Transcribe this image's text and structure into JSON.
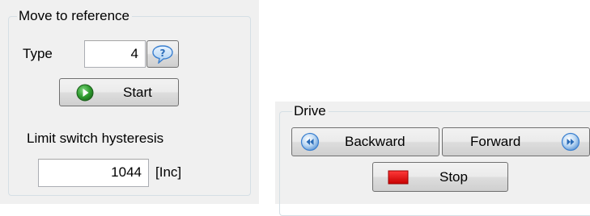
{
  "move_to_reference": {
    "title": "Move to reference",
    "type_label": "Type",
    "type_value": "4",
    "help_icon": "help-speech-bubble-icon",
    "start_label": "Start",
    "start_icon": "play-circle-icon",
    "hysteresis_label": "Limit switch hysteresis",
    "hysteresis_value": "1044",
    "hysteresis_unit": "[Inc]"
  },
  "drive": {
    "title": "Drive",
    "backward_label": "Backward",
    "backward_icon": "rewind-circle-icon",
    "forward_label": "Forward",
    "forward_icon": "fast-forward-circle-icon",
    "stop_label": "Stop",
    "stop_icon": "stop-square-icon"
  },
  "colors": {
    "panel_bg": "#f0f0f0",
    "start_icon": "#2e8b2e",
    "stop_icon": "#e00000",
    "nav_icon": "#3a7fcf"
  }
}
